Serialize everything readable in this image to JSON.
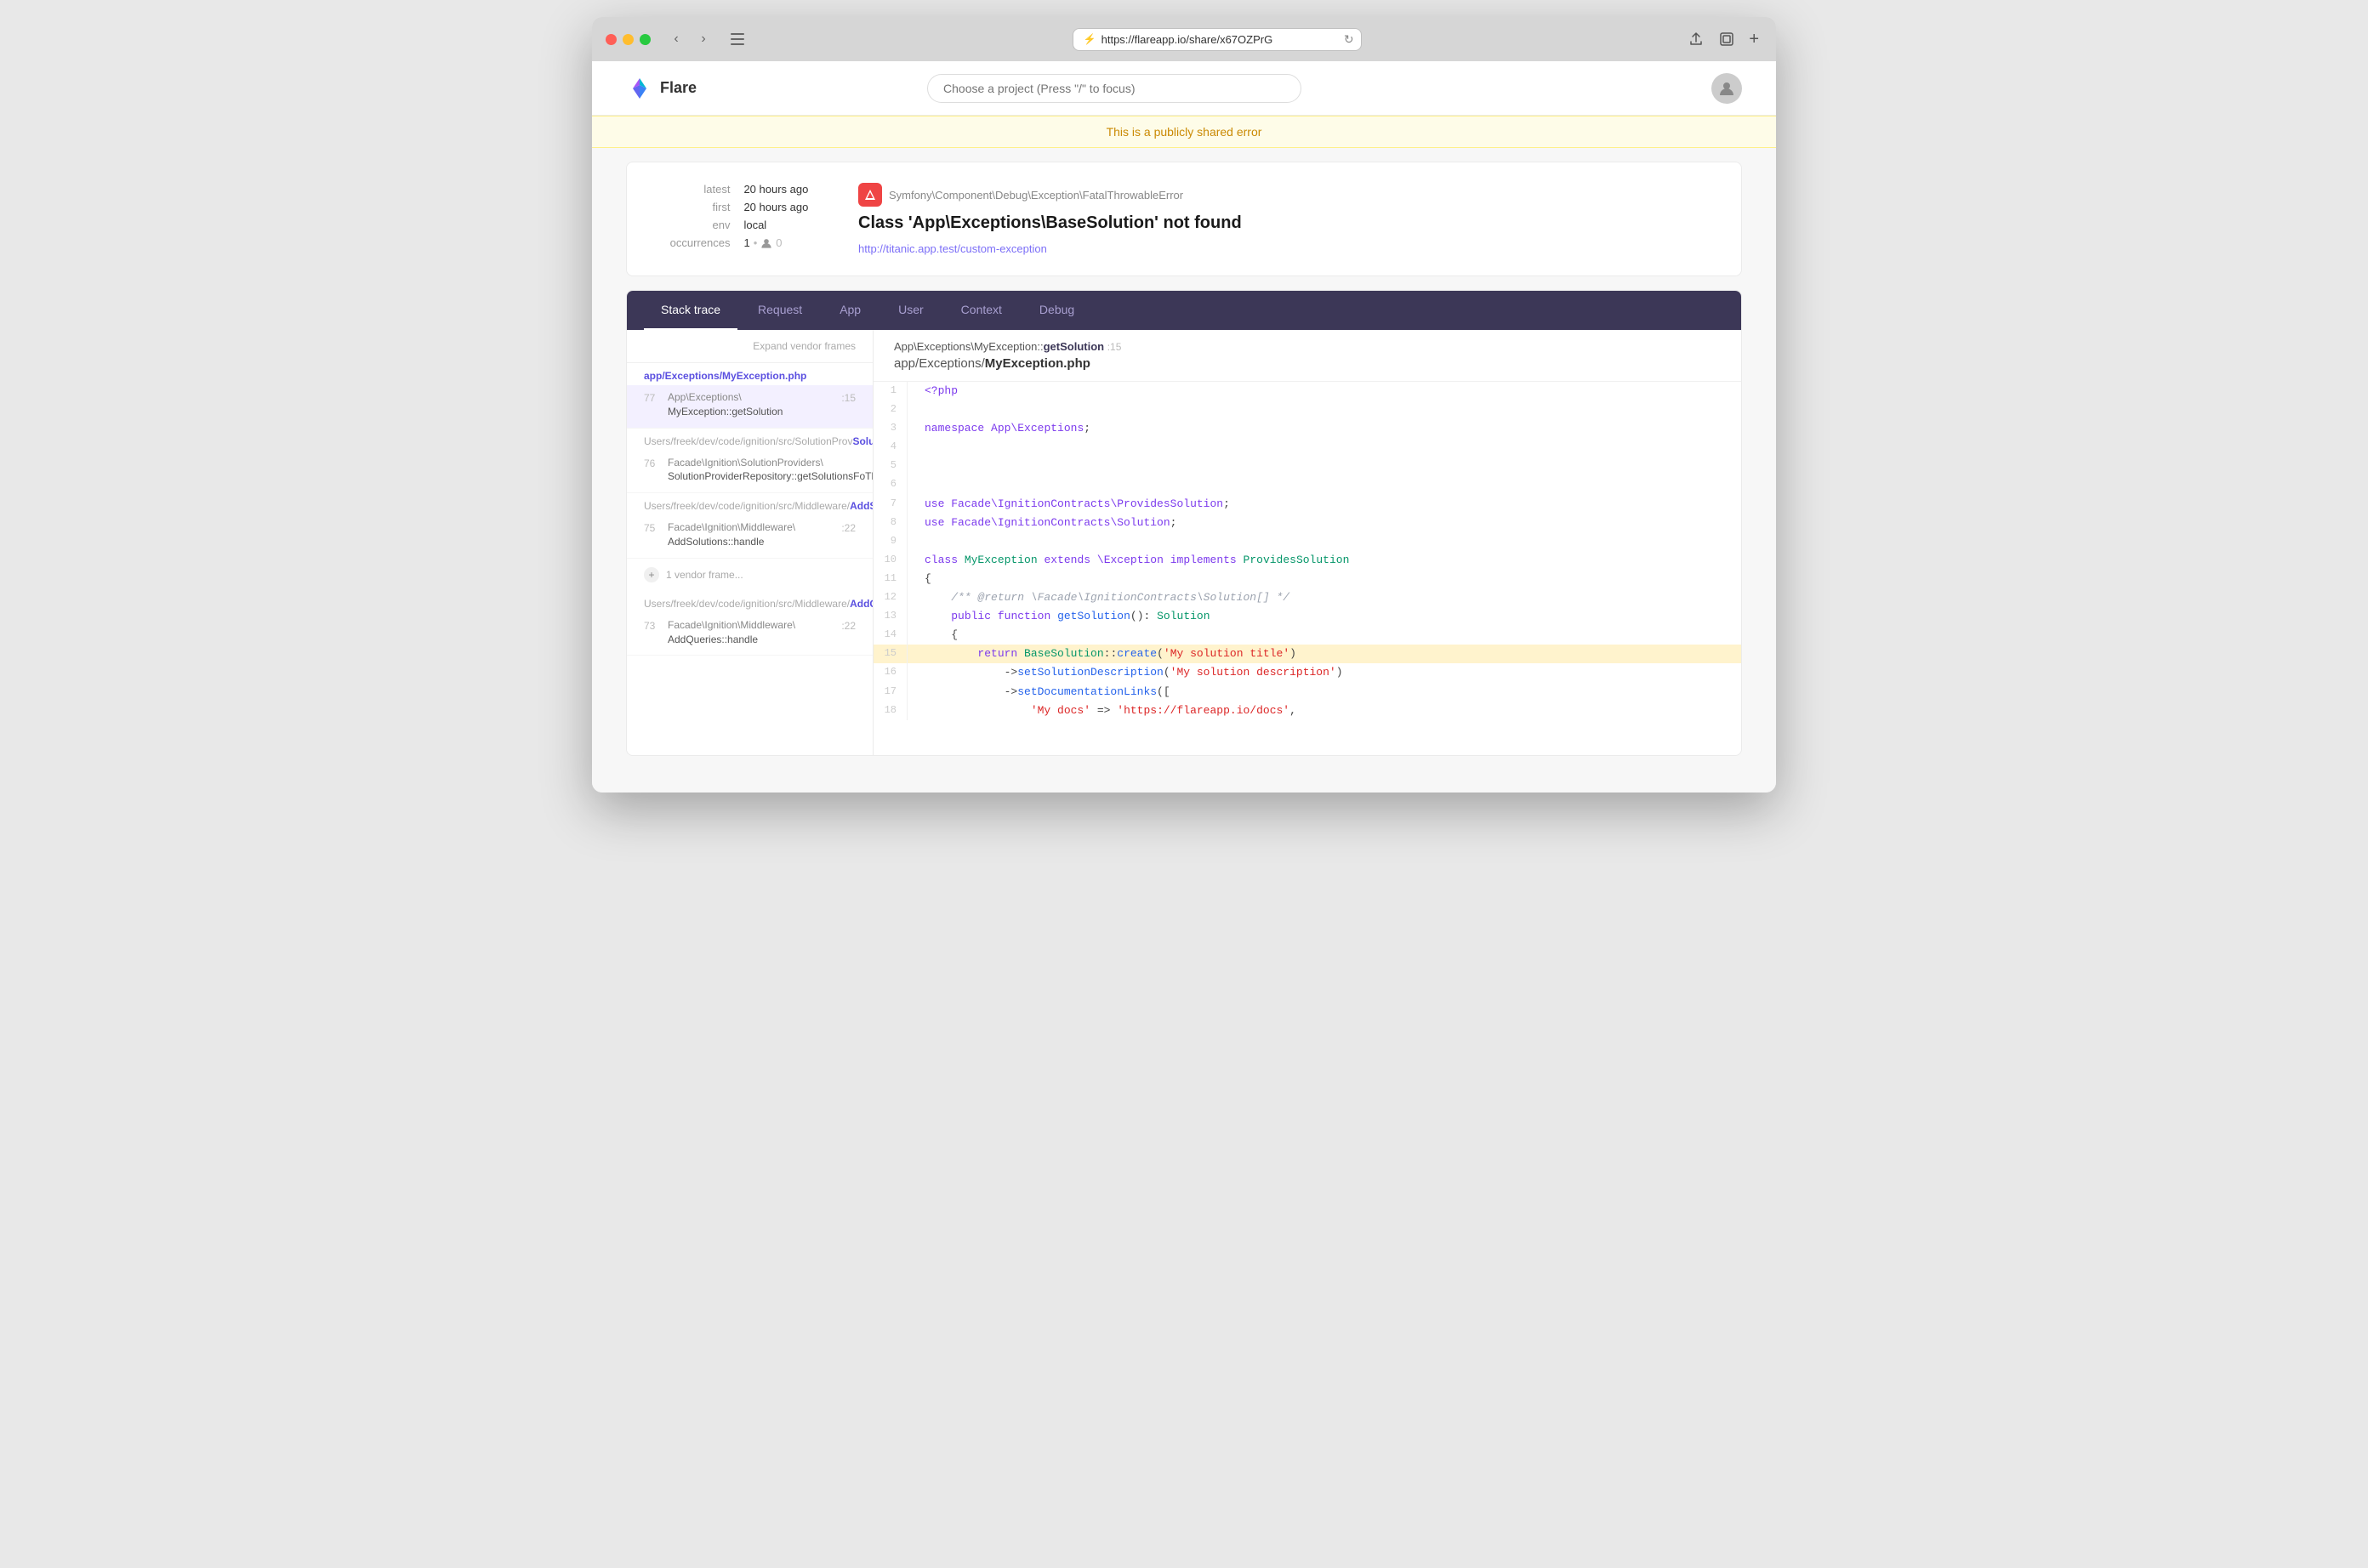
{
  "browser": {
    "url": "https://flareapp.io/share/x67OZPrG",
    "back_btn": "‹",
    "forward_btn": "›"
  },
  "nav": {
    "logo_text": "Flare",
    "search_placeholder": "Choose a project (Press \"/\" to focus)"
  },
  "public_banner": {
    "text": "This is a publicly shared error"
  },
  "error": {
    "latest_label": "latest",
    "latest_value": "20 hours ago",
    "first_label": "first",
    "first_value": "20 hours ago",
    "env_label": "env",
    "env_value": "local",
    "occurrences_label": "occurrences",
    "occurrences_value": "1",
    "class": "Symfony\\Component\\Debug\\Exception\\FatalThrowableError",
    "message": "Class 'App\\Exceptions\\BaseSolution' not found",
    "url": "http://titanic.app.test/custom-exception"
  },
  "tabs": {
    "items": [
      {
        "id": "stack-trace",
        "label": "Stack trace",
        "active": true
      },
      {
        "id": "request",
        "label": "Request",
        "active": false
      },
      {
        "id": "app",
        "label": "App",
        "active": false
      },
      {
        "id": "user",
        "label": "User",
        "active": false
      },
      {
        "id": "context",
        "label": "Context",
        "active": false
      },
      {
        "id": "debug",
        "label": "Debug",
        "active": false
      }
    ]
  },
  "stack": {
    "expand_vendor_label": "Expand vendor frames",
    "active_frame": {
      "class": "App\\Exceptions\\",
      "method": "MyException::getSolution",
      "line": 15,
      "file_path": "app/Exceptions/",
      "file_name": "MyException.php"
    },
    "frames": [
      {
        "number": 77,
        "file": "app/Exceptions/MyException.php",
        "file_dir": "app/Exceptions/",
        "file_base": "MyException.php",
        "class": "App\\Exceptions\\",
        "method": "MyException::getSolution",
        "line": 15,
        "active": true
      },
      {
        "number": 76,
        "file": "Users/freek/dev/code/ignition/src/SolutionProv...",
        "file_dir": "Users/freek/dev/code/ignition/src/SolutionProv",
        "file_base": "SolutionProviderRepository.php",
        "class": "Facade\\Ignition\\SolutionProviders\\",
        "method": "SolutionProviderRepository::getSolutionsFoTh...",
        "line": null,
        "active": false
      },
      {
        "number": 75,
        "file": "Users/freek/dev/code/ignition/src/Middleware/AddSolutions.php",
        "file_dir": "Users/freek/dev/code/ignition/src/Middleware/",
        "file_base": "AddSolutions.php",
        "class": "Facade\\Ignition\\Middleware\\",
        "method": "AddSolutions::handle",
        "line": 22,
        "active": false
      }
    ],
    "vendor_toggle": "1 vendor frame...",
    "frames_below": [
      {
        "number": 73,
        "file": "Users/freek/dev/code/ignition/src/Middleware/AddQueries.php",
        "file_dir": "Users/freek/dev/code/ignition/src/Middleware/",
        "file_base": "AddQueries.php",
        "class": "Facade\\Ignition\\Middleware\\",
        "method": "AddQueries::handle",
        "line": 22,
        "active": false
      }
    ]
  },
  "code": {
    "lines": [
      {
        "num": 1,
        "content": "<?php",
        "highlighted": false
      },
      {
        "num": 2,
        "content": "",
        "highlighted": false
      },
      {
        "num": 3,
        "content": "namespace App\\Exceptions;",
        "highlighted": false
      },
      {
        "num": 4,
        "content": "",
        "highlighted": false
      },
      {
        "num": 5,
        "content": "",
        "highlighted": false
      },
      {
        "num": 6,
        "content": "",
        "highlighted": false
      },
      {
        "num": 7,
        "content": "use Facade\\IgnitionContracts\\ProvidesSolution;",
        "highlighted": false
      },
      {
        "num": 8,
        "content": "use Facade\\IgnitionContracts\\Solution;",
        "highlighted": false
      },
      {
        "num": 9,
        "content": "",
        "highlighted": false
      },
      {
        "num": 10,
        "content": "class MyException extends \\Exception implements ProvidesSolution",
        "highlighted": false
      },
      {
        "num": 11,
        "content": "{",
        "highlighted": false
      },
      {
        "num": 12,
        "content": "    /** @return \\Facade\\IgnitionContracts\\Solution[] */",
        "highlighted": false
      },
      {
        "num": 13,
        "content": "    public function getSolution(): Solution",
        "highlighted": false
      },
      {
        "num": 14,
        "content": "    {",
        "highlighted": false
      },
      {
        "num": 15,
        "content": "        return BaseSolution::create('My solution title')",
        "highlighted": true
      },
      {
        "num": 16,
        "content": "            ->setSolutionDescription('My solution description')",
        "highlighted": false
      },
      {
        "num": 17,
        "content": "            ->setDocumentationLinks([",
        "highlighted": false
      },
      {
        "num": 18,
        "content": "                'My docs' => 'https://flareapp.io/docs',",
        "highlighted": false
      }
    ]
  }
}
